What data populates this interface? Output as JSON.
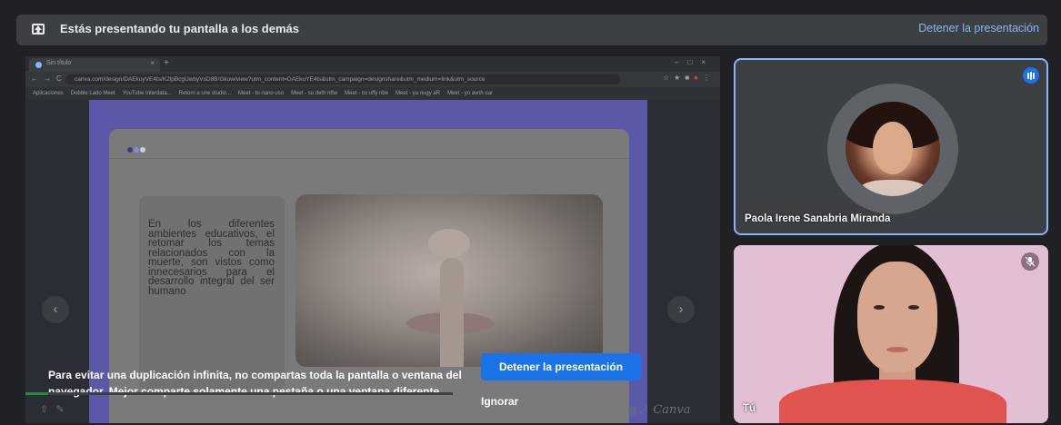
{
  "banner": {
    "icon": "present-screen-icon",
    "message": "Estás presentando tu pantalla a los demás",
    "stop_label": "Detener la presentación"
  },
  "shared_screen": {
    "browser": {
      "tab_title": "Sin título",
      "url": "canva.com/design/DAEkuyVE4ts/K2lpBcgUwbyVsD8B/Gkuw/view?utm_content=DAEkuYE4ts&utm_campaign=designshare&utm_medium=link&utm_source",
      "bookmarks": [
        "Aplicaciones",
        "Dobble Lado Meet",
        "YouTube Interdata...",
        "Retorn a une studio...",
        "Meet - to nano uso",
        "Meet - su deth ntfw",
        "Meet - cu uffy nbe",
        "Meet - ya nugy aR",
        "Meet - yo avnh uar"
      ]
    },
    "slide": {
      "text": "En los diferentes ambientes educativos, el retomar los temas relacionados con la muerte, son vistos como innecesarios para el desarrollo integral del ser humano",
      "dot_colors": [
        "#3b3b80",
        "#8a8ad0",
        "#c9c9e8"
      ]
    },
    "brand_text": "Canva"
  },
  "warning": {
    "message": "Para evitar una duplicación infinita, no compartas toda la pantalla o ventana del navegador. Mejor comparte solamente una pestaña o una ventana diferente.",
    "stop_button": "Detener la presentación",
    "ignore_button": "Ignorar"
  },
  "participants": [
    {
      "name": "Paola Irene Sanabria Miranda",
      "state": "speaking"
    },
    {
      "name": "Tú",
      "state": "muted"
    }
  ],
  "colors": {
    "accent_blue": "#1a73e8",
    "link_blue": "#8ab4f8",
    "background": "#202124"
  }
}
